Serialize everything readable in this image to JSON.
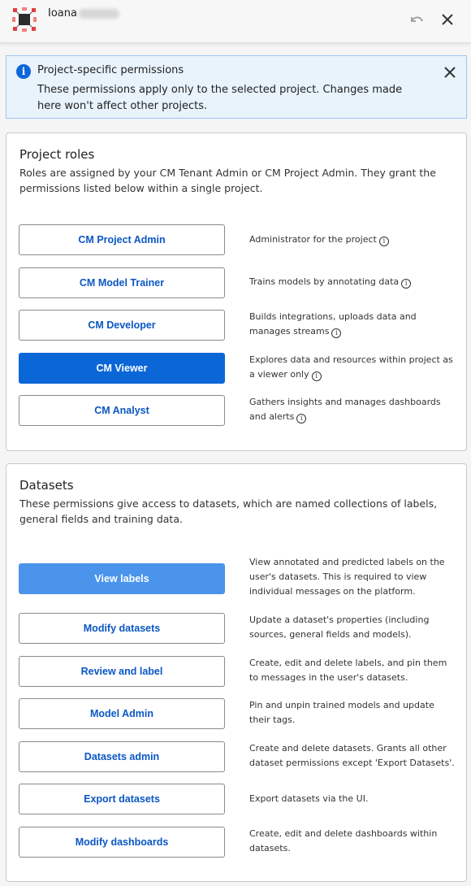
{
  "header": {
    "user_name": "Ioana",
    "undo_icon": "undo-icon",
    "close_icon": "close-icon"
  },
  "banner": {
    "title": "Project-specific permissions",
    "text": "These permissions apply only to the selected project. Changes made here won't affect other projects.",
    "accent": "#0b66d8",
    "background": "#e8f3fc"
  },
  "roles": {
    "title": "Project roles",
    "description": "Roles are assigned by your CM Tenant Admin or CM Project Admin. They grant the permissions listed below within a single project.",
    "items": [
      {
        "label": "CM Project Admin",
        "description": "Administrator for the project",
        "selected": false
      },
      {
        "label": "CM Model Trainer",
        "description": "Trains models by annotating data",
        "selected": false
      },
      {
        "label": "CM Developer",
        "description": "Builds integrations, uploads data and manages streams",
        "selected": false
      },
      {
        "label": "CM Viewer",
        "description": "Explores data and resources within project as a viewer only",
        "selected": true
      },
      {
        "label": "CM Analyst",
        "description": "Gathers insights and manages dashboards and alerts",
        "selected": false
      }
    ]
  },
  "datasets": {
    "title": "Datasets",
    "description": "These permissions give access to datasets, which are named collections of labels, general fields and training data.",
    "items": [
      {
        "label": "View labels",
        "description": "View annotated and predicted labels on the user's datasets. This is required to view individual messages on the platform.",
        "selected": true
      },
      {
        "label": "Modify datasets",
        "description": "Update a dataset's properties (including sources, general fields and models).",
        "selected": false
      },
      {
        "label": "Review and label",
        "description": "Create, edit and delete labels, and pin them to messages in the user's datasets.",
        "selected": false
      },
      {
        "label": "Model Admin",
        "description": "Pin and unpin trained models and update their tags.",
        "selected": false
      },
      {
        "label": "Datasets admin",
        "description": "Create and delete datasets. Grants all other dataset permissions except 'Export Datasets'.",
        "selected": false
      },
      {
        "label": "Export datasets",
        "description": "Export datasets via the UI.",
        "selected": false
      },
      {
        "label": "Modify dashboards",
        "description": "Create, edit and delete dashboards within datasets.",
        "selected": false
      }
    ]
  },
  "colors": {
    "selected_role": "#0b66d8",
    "granted_permission": "#4a94ec",
    "button_text": "#0a57c4"
  }
}
